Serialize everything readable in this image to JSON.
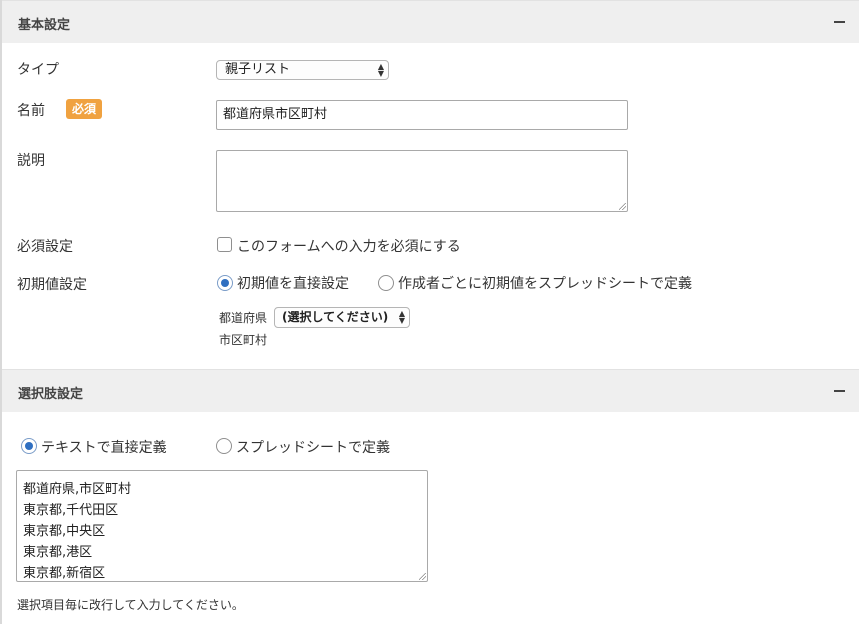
{
  "basic_section": {
    "title": "基本設定",
    "type_label": "タイプ",
    "type_value": "親子リスト",
    "name_label": "名前",
    "required_badge": "必須",
    "name_value": "都道府県市区町村",
    "description_label": "説明",
    "description_value": "",
    "required_setting_label": "必須設定",
    "required_checkbox_label": "このフォームへの入力を必須にする",
    "required_checked": false,
    "initial_value_label": "初期値設定",
    "initial_option_direct": "初期値を直接設定",
    "initial_option_spreadsheet": "作成者ごとに初期値をスプレッドシートで定義",
    "initial_selected": "direct",
    "parent_field_label": "都道府県",
    "parent_select_value": "(選択してください)",
    "child_field_label": "市区町村"
  },
  "choices_section": {
    "title": "選択肢設定",
    "option_text_direct": "テキストで直接定義",
    "option_spreadsheet": "スプレッドシートで定義",
    "selected": "text",
    "lines": [
      "都道府県,市区町村",
      "東京都,千代田区",
      "東京都,中央区",
      "東京都,港区",
      "東京都,新宿区"
    ],
    "help_text": "選択項目毎に改行して入力してください。"
  },
  "colors": {
    "header_bg": "#efefef",
    "badge": "#f0a240",
    "radio_selected": "#2f6fc1"
  }
}
